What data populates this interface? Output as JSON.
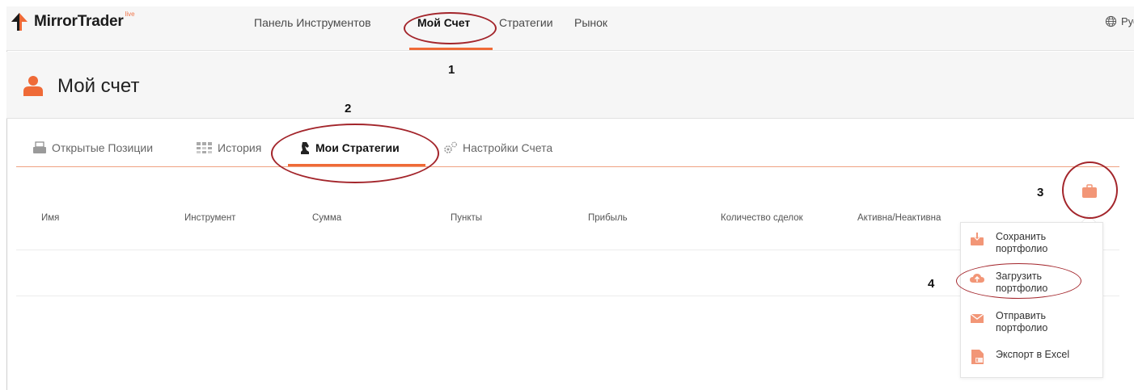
{
  "app": {
    "logo_text": "MirrorTrader",
    "logo_sup": "live"
  },
  "nav": {
    "items": [
      {
        "label": "Панель Инструментов"
      },
      {
        "label": "Мой Счет"
      },
      {
        "label": "Стратегии"
      },
      {
        "label": "Рынок"
      }
    ],
    "language": "Русс"
  },
  "page": {
    "title": "Мой счет"
  },
  "tabs": [
    {
      "label": "Открытые Позиции",
      "icon": "printer-icon"
    },
    {
      "label": "История",
      "icon": "grid-icon"
    },
    {
      "label": "Мои Стратегии",
      "icon": "chess-knight-icon"
    },
    {
      "label": "Настройки Счета",
      "icon": "gears-icon"
    }
  ],
  "table": {
    "columns": [
      "Имя",
      "Инструмент",
      "Сумма",
      "Пункты",
      "Прибыль",
      "Количество сделок",
      "Активна/Неактивна"
    ]
  },
  "portfolio_menu": {
    "items": [
      {
        "label": "Сохранить портфолио",
        "icon": "save-box-icon"
      },
      {
        "label": "Загрузить портфолио",
        "icon": "cloud-upload-icon"
      },
      {
        "label": "Отправить портфолио",
        "icon": "envelope-icon"
      },
      {
        "label": "Экспорт в Excel",
        "icon": "excel-file-icon"
      }
    ]
  },
  "annotations": [
    "1",
    "2",
    "3",
    "4"
  ],
  "colors": {
    "accent": "#ef6a37",
    "annotation": "#a3252b",
    "header_bg": "#f6f6f6"
  }
}
